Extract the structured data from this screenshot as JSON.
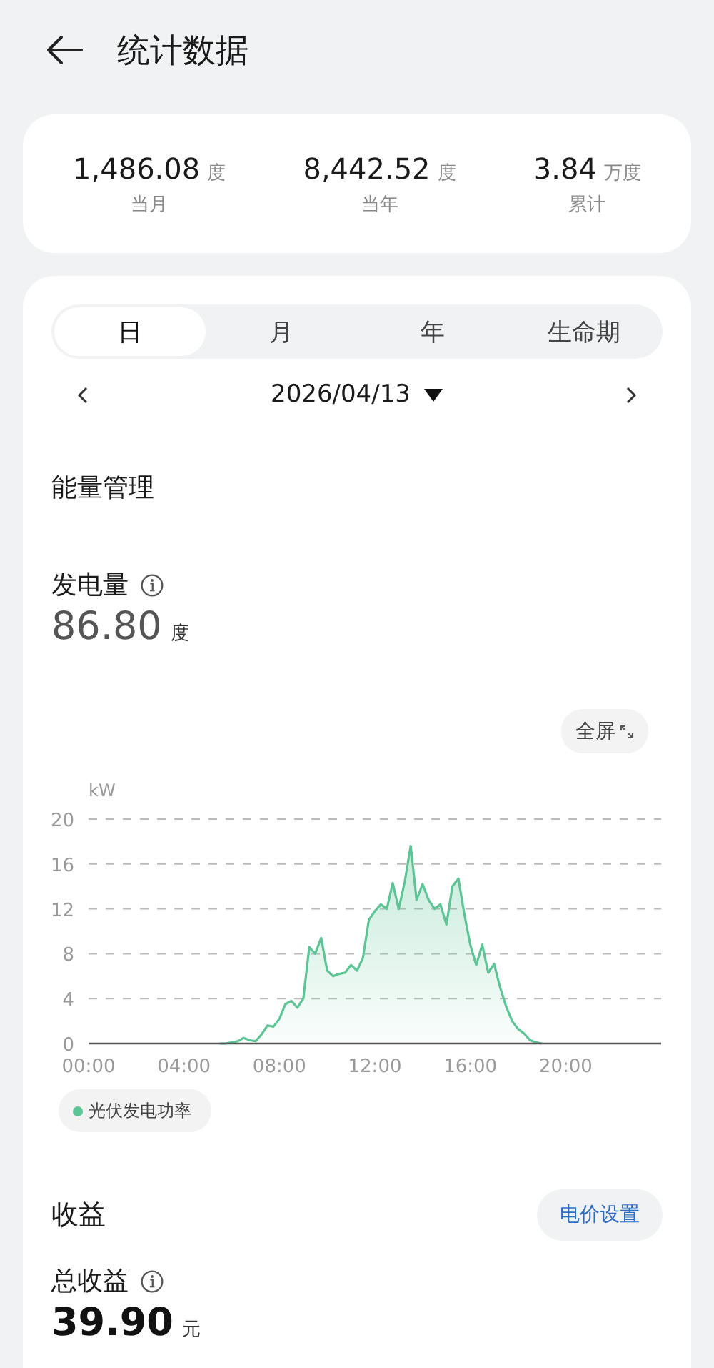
{
  "header": {
    "title": "统计数据"
  },
  "summary": [
    {
      "value": "1,486.08",
      "unit": "度",
      "label": "当月"
    },
    {
      "value": "8,442.52",
      "unit": "度",
      "label": "当年"
    },
    {
      "value": "3.84",
      "unit": "万度",
      "label": "累计"
    }
  ],
  "period_tabs": [
    {
      "label": "日",
      "selected": true
    },
    {
      "label": "月",
      "selected": false
    },
    {
      "label": "年",
      "selected": false
    },
    {
      "label": "生命期",
      "selected": false
    }
  ],
  "date_picker": {
    "date": "2026/04/13"
  },
  "energy": {
    "title": "能量管理",
    "metric_label": "发电量",
    "value": "86.80",
    "unit": "度",
    "fullscreen_button": "全屏",
    "chart_data": {
      "type": "area",
      "grid": true,
      "ylabel": "kW",
      "xlim": [
        0,
        24
      ],
      "ylim": [
        0,
        20
      ],
      "xticks": [
        {
          "value": 0,
          "label": "00:00"
        },
        {
          "value": 4,
          "label": "04:00"
        },
        {
          "value": 8,
          "label": "08:00"
        },
        {
          "value": 12,
          "label": "12:00"
        },
        {
          "value": 16,
          "label": "16:00"
        },
        {
          "value": 20,
          "label": "20:00"
        }
      ],
      "yticks": [
        0,
        4,
        8,
        12,
        16,
        20
      ],
      "x": [
        5.5,
        5.75,
        6,
        6.25,
        6.5,
        6.75,
        7,
        7.25,
        7.5,
        7.75,
        8,
        8.25,
        8.5,
        8.75,
        9,
        9.25,
        9.5,
        9.75,
        10,
        10.25,
        10.5,
        10.75,
        11,
        11.25,
        11.5,
        11.75,
        12,
        12.25,
        12.5,
        12.75,
        13,
        13.25,
        13.5,
        13.75,
        14,
        14.25,
        14.5,
        14.75,
        15,
        15.25,
        15.5,
        15.75,
        16,
        16.25,
        16.5,
        16.75,
        17,
        17.25,
        17.5,
        17.75,
        18,
        18.25,
        18.5,
        18.75,
        19
      ],
      "series": [
        {
          "name": "光伏发电功率",
          "color": "#5cc495",
          "values": [
            0,
            0,
            0.1,
            0.2,
            0.5,
            0.3,
            0.2,
            0.8,
            1.6,
            1.5,
            2.2,
            3.5,
            3.8,
            3.2,
            4,
            8.6,
            8,
            9.4,
            6.5,
            6,
            6.2,
            6.3,
            7,
            6.5,
            7.6,
            11,
            11.8,
            12.4,
            12,
            14.3,
            12,
            14.4,
            17.6,
            12.8,
            14.2,
            12.8,
            12,
            12.4,
            10.6,
            14,
            14.7,
            11.5,
            8.8,
            7,
            8.8,
            6.3,
            7.1,
            5,
            3.3,
            2,
            1.3,
            0.9,
            0.3,
            0.1,
            0
          ]
        }
      ]
    }
  },
  "revenue": {
    "title": "收益",
    "button": "电价设置",
    "metric_label": "总收益",
    "value": "39.90",
    "unit": "元"
  }
}
